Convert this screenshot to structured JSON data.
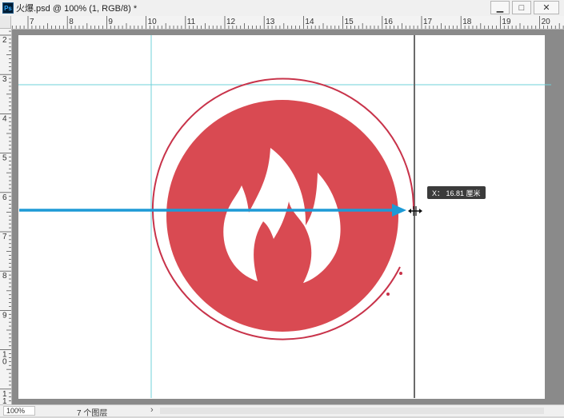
{
  "window": {
    "app_icon_label": "Ps",
    "title": "火爆.psd @ 100% (1, RGB/8) *",
    "buttons": [
      "minimize",
      "maximize",
      "close"
    ]
  },
  "rulers": {
    "unit": "cm",
    "horizontal_labels": [
      "7",
      "8",
      "9",
      "10",
      "11",
      "12",
      "13",
      "14",
      "15",
      "16",
      "17",
      "18",
      "19",
      "20"
    ],
    "vertical_labels": [
      "2",
      "3",
      "4",
      "5",
      "6",
      "7",
      "8",
      "9",
      "10",
      "11"
    ]
  },
  "canvas": {
    "guides": {
      "vertical_cm": [
        10,
        16.81
      ],
      "horizontal_cm": [
        3.3
      ]
    },
    "artwork": "red circle with white flame icon",
    "colors": {
      "primary_red": "#d94a52",
      "outline_red": "#c8334a",
      "guide_cyan": "#6fd0d8",
      "arrow_blue": "#1d9ad6",
      "background": "#ffffff"
    }
  },
  "measurement_tooltip": {
    "text": "X： 16.81 厘米"
  },
  "statusbar": {
    "zoom": "100%",
    "layers": "7 个图层",
    "arrow": "›"
  }
}
